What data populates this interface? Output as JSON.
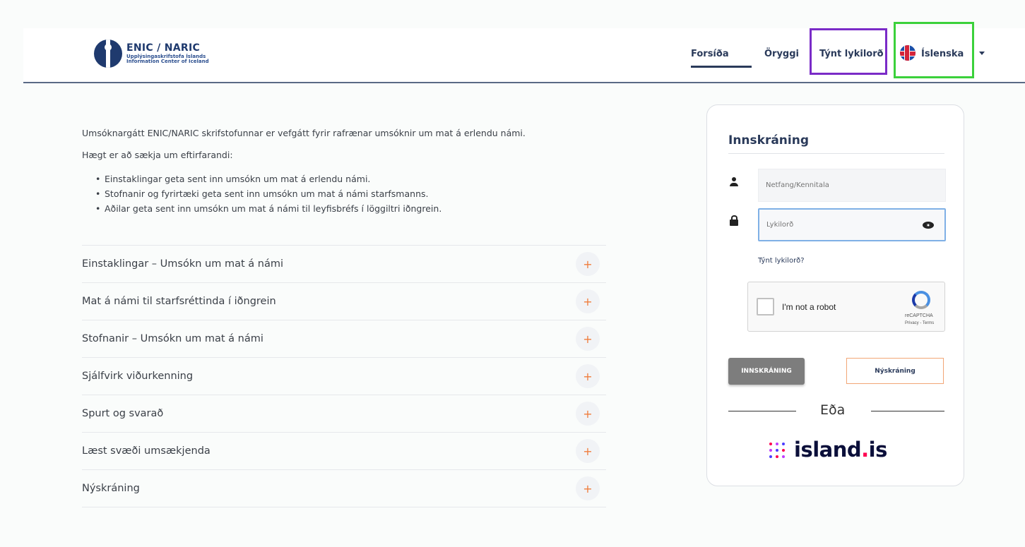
{
  "header": {
    "logo_title": "ENIC / NARIC",
    "logo_sub1": "Upplýsingaskrifstofa Íslands",
    "logo_sub2": "Information Center of Iceland",
    "nav": {
      "home": "Forsíða",
      "security": "Öryggi",
      "forgot": "Týnt lykilorð",
      "language": "Íslenska"
    }
  },
  "intro": {
    "p1": "Umsóknargátt ENIC/NARIC skrifstofunnar er vefgátt fyrir rafrænar umsóknir um mat á erlendu námi.",
    "p2": "Hægt er að sækja um eftirfarandi:",
    "bullets": [
      "Einstaklingar geta sent inn umsókn um mat á erlendu námi.",
      "Stofnanir og fyrirtæki geta sent inn umsókn um mat á námi starfsmanns.",
      "Aðilar geta sent inn umsókn um mat á námi til leyfisbréfs í löggiltri iðngrein."
    ]
  },
  "accordion": [
    {
      "label": "Einstaklingar – Umsókn um mat á námi",
      "icon": "+"
    },
    {
      "label": "Mat á námi til starfsréttinda í iðngrein",
      "icon": "+"
    },
    {
      "label": "Stofnanir – Umsókn um mat á námi",
      "icon": "+"
    },
    {
      "label": "Sjálfvirk viðurkenning",
      "icon": "+"
    },
    {
      "label": "Spurt og svarað",
      "icon": "+"
    },
    {
      "label": "Læst svæði umsækjenda",
      "icon": "+"
    },
    {
      "label": "Nýskráning",
      "icon": "+"
    }
  ],
  "login": {
    "title": "Innskráning",
    "email_placeholder": "Netfang/Kennitala",
    "password_placeholder": "Lykilorð",
    "forgot_link": "Týnt lykilorð?",
    "captcha_label": "I'm not a robot",
    "captcha_brand": "reCAPTCHA",
    "captcha_terms": "Privacy - Terms",
    "login_button": "INNSKRÁNING",
    "register_button": "Nýskráning",
    "or_text": "Eða",
    "island_brand": "island",
    "island_tld": "is"
  },
  "colors": {
    "nav_text": "#2a3a5a",
    "accent_orange": "#f07c3c",
    "highlight_purple": "#7a2bc7",
    "highlight_green": "#3bd13b",
    "island_pink": "#ff0050"
  }
}
